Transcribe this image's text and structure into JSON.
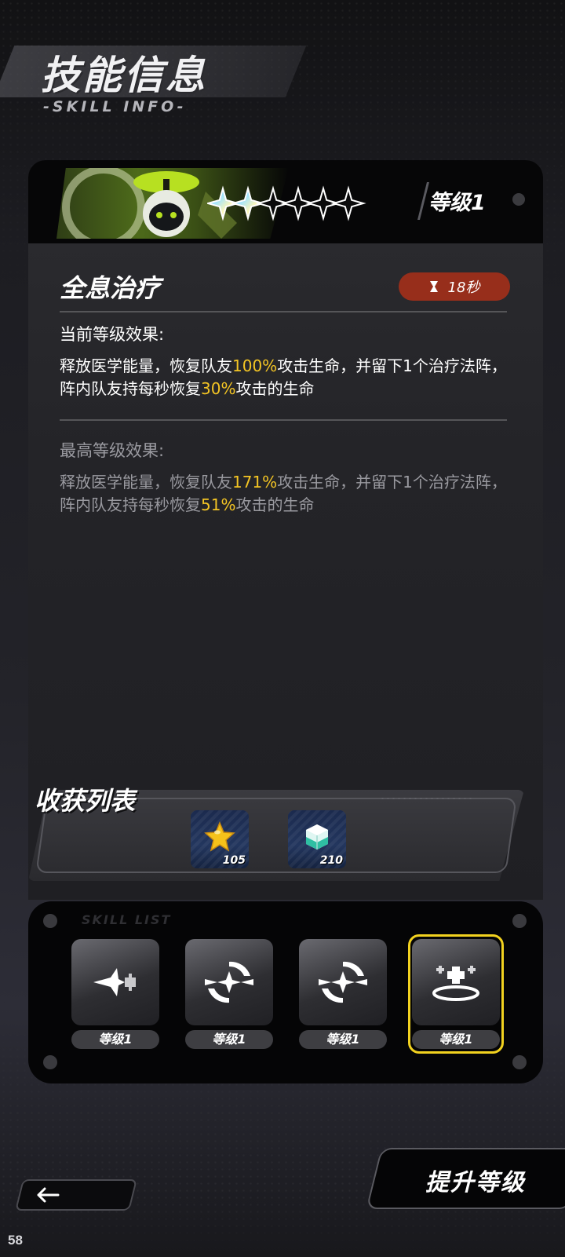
{
  "header": {
    "title": "技能信息",
    "subtitle": "-SKILL INFO-"
  },
  "skill_card": {
    "level_label": "等级1",
    "star_rating": 2,
    "star_max": 6,
    "skill_name": "全息治疗",
    "cooldown": "18秒",
    "cooldown_icon": "hourglass-icon",
    "current_label": "当前等级效果:",
    "current_effect": {
      "p1": "释放医学能量，恢复队友",
      "v1": "100%",
      "p2": "攻击生命，并留下1个治疗法阵，阵内队友持每秒恢复",
      "v2": "30%",
      "p3": "攻击的生命"
    },
    "max_label": "最高等级效果:",
    "max_effect": {
      "p1": "释放医学能量，恢复队友",
      "v1": "171%",
      "p2": "攻击生命，并留下1个治疗法阵，阵内队友持每秒恢复",
      "v2": "51%",
      "p3": "攻击的生命"
    }
  },
  "rewards": {
    "title": "收获列表",
    "items": [
      {
        "icon": "star-icon",
        "count": "105"
      },
      {
        "icon": "crystal-cube-icon",
        "count": "210"
      }
    ]
  },
  "skills_panel": {
    "decor_text": "SKILL LIST",
    "slots": [
      {
        "icon": "dash-heal-icon",
        "level": "等级1",
        "selected": false
      },
      {
        "icon": "orbit-star-icon",
        "level": "等级1",
        "selected": false
      },
      {
        "icon": "orbit-star-icon",
        "level": "等级1",
        "selected": false
      },
      {
        "icon": "holo-heal-icon",
        "level": "等级1",
        "selected": true
      }
    ]
  },
  "nav": {
    "back_icon": "arrow-left-icon",
    "upgrade_label": "提升等级"
  },
  "page_number": "58",
  "colors": {
    "accent_yellow": "#f4c524",
    "cooldown_red": "#972e1b",
    "selected_border": "#f2d21f"
  }
}
